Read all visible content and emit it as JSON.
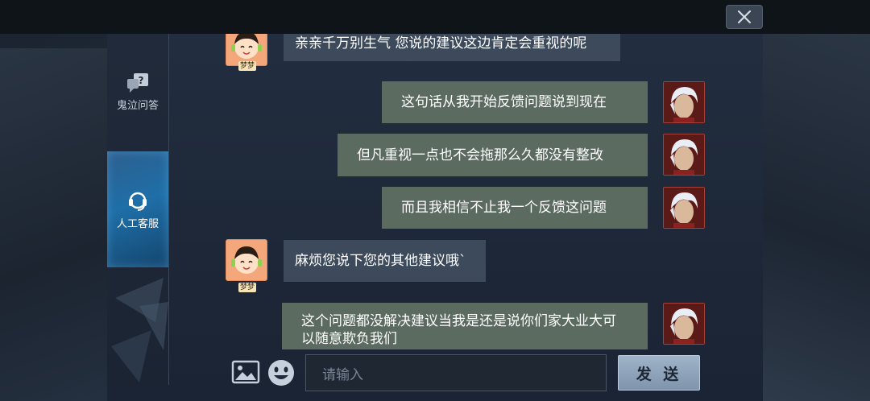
{
  "window": {
    "close_icon": "close-icon"
  },
  "sidebar": {
    "items": [
      {
        "label": "鬼泣问答",
        "icon": "question-bubble-icon",
        "active": false
      },
      {
        "label": "人工客服",
        "icon": "headset-icon",
        "active": true
      }
    ]
  },
  "chat": {
    "messages": [
      {
        "from": "agent",
        "agent_name": "梦梦",
        "text": "亲亲千万别生气 您说的建议这边肯定会重视的呢"
      },
      {
        "from": "user",
        "text": "这句话从我开始反馈问题说到现在"
      },
      {
        "from": "user",
        "text": "但凡重视一点也不会拖那么久都没有整改"
      },
      {
        "from": "user",
        "text": "而且我相信不止我一个反馈这问题"
      },
      {
        "from": "agent",
        "agent_name": "梦梦",
        "text": "麻烦您说下您的其他建议哦`"
      },
      {
        "from": "user",
        "text": "这个问题都没解决建议当我是还是说你们家大业大可以随意欺负我们"
      }
    ]
  },
  "composer": {
    "image_icon": "image-icon",
    "emoji_icon": "emoji-icon",
    "placeholder": "请输入",
    "send_label": "发 送"
  },
  "colors": {
    "agent_bubble": "#3c4a5b",
    "user_bubble": "#5b6b5f",
    "active_tab": "#1f6fa8"
  }
}
